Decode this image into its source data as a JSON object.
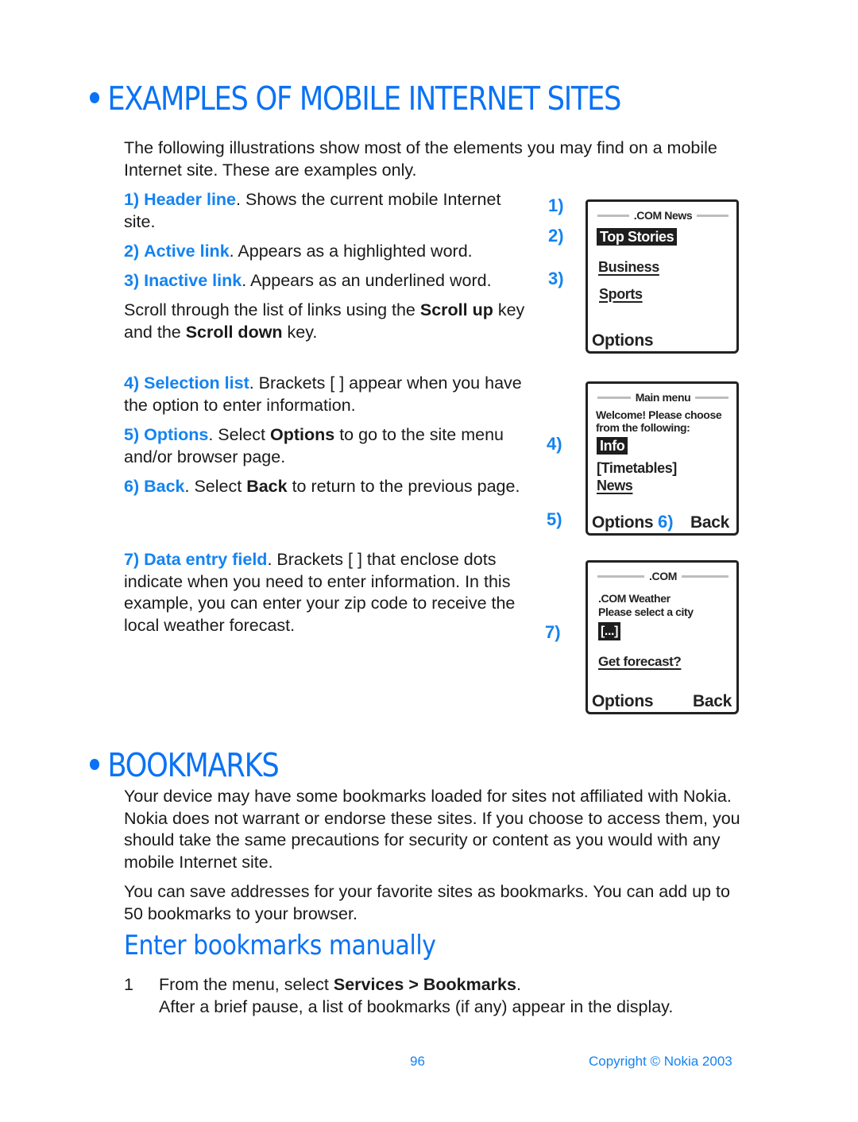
{
  "section1": {
    "title": "EXAMPLES OF MOBILE INTERNET SITES",
    "intro": "The following illustrations show most of the elements you may find on a mobile Internet site. These are examples only.",
    "items": [
      {
        "num": "1)",
        "term": "Header line",
        "desc": ". Shows the current mobile Internet site."
      },
      {
        "num": "2)",
        "term": "Active link",
        "desc": ". Appears as a highlighted word."
      },
      {
        "num": "3)",
        "term": "Inactive link",
        "desc": ". Appears as an underlined word."
      },
      {
        "num": "4)",
        "term": "Selection list",
        "desc": ". Brackets [ ] appear when you have the option to enter information."
      },
      {
        "num": "5)",
        "term": "Options",
        "desc_pre": ". Select ",
        "desc_bold": "Options",
        "desc_post": " to go to the site menu and/or browser page."
      },
      {
        "num": "6)",
        "term": "Back",
        "desc_pre": ". Select ",
        "desc_bold": "Back",
        "desc_post": " to return to the previous page."
      },
      {
        "num": "7)",
        "term": "Data entry field",
        "desc": ". Brackets [ ] that enclose dots indicate when you need to enter information. In this example, you can enter your zip code to receive the local weather forecast."
      }
    ],
    "scroll_text": {
      "pre": "Scroll through the list of links using the ",
      "key1": "Scroll up",
      "mid": " key and the ",
      "key2": "Scroll down",
      "post": " key."
    }
  },
  "screens": [
    {
      "labels": [
        "1)",
        "2)",
        "3)"
      ],
      "header": ".COM News",
      "active_link": "Top Stories",
      "links": [
        "Business",
        "Sports"
      ],
      "left_soft_key": "Options"
    },
    {
      "labels": [
        "4)",
        "5)",
        "6)"
      ],
      "header": "Main menu",
      "message_line1": "Welcome! Please choose",
      "message_line2": "from the following:",
      "active_link": "Info",
      "selection_list": "[Timetables]",
      "links": [
        "News"
      ],
      "left_soft_key": "Options",
      "right_soft_key": "Back"
    },
    {
      "labels": [
        "7)"
      ],
      "header": ".COM",
      "message_line1": ".COM Weather",
      "message_line2": "Please select a city",
      "data_entry": "[...]",
      "links": [
        "Get forecast?"
      ],
      "left_soft_key": "Options",
      "right_soft_key": "Back"
    }
  ],
  "section2": {
    "title": "BOOKMARKS",
    "para1": "Your device may have some bookmarks loaded for sites not affiliated with Nokia. Nokia does not warrant or endorse these sites. If you choose to access them, you should take the same precautions for security or content as you would with any mobile Internet site.",
    "para2": "You can save addresses for your favorite sites as bookmarks. You can add up to 50 bookmarks to your browser.",
    "subtitle": "Enter bookmarks manually",
    "steps": [
      {
        "num": "1",
        "pre": "From the menu, select ",
        "bold": "Services > Bookmarks",
        "post": ".",
        "detail": "After a brief pause, a list of bookmarks (if any) appear in the display."
      }
    ]
  },
  "footer": {
    "page_number": "96",
    "copyright": "Copyright © Nokia 2003"
  },
  "colors": {
    "heading_blue": "#0a72f5",
    "term_blue": "#1483f0",
    "text": "#1a1a1a"
  }
}
